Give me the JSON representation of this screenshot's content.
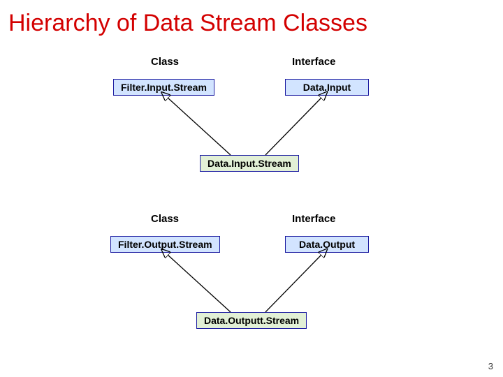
{
  "title": "Hierarchy of Data Stream Classes",
  "labels": {
    "class1": "Class",
    "interface1": "Interface",
    "class2": "Class",
    "interface2": "Interface"
  },
  "boxes": {
    "filterInputStream": "Filter.Input.Stream",
    "dataInput": "Data.Input",
    "dataInputStream": "Data.Input.Stream",
    "filterOutputStream": "Filter.Output.Stream",
    "dataOutput": "Data.Output",
    "dataOutputStream": "Data.Outputt.Stream"
  },
  "pageNumber": "3"
}
